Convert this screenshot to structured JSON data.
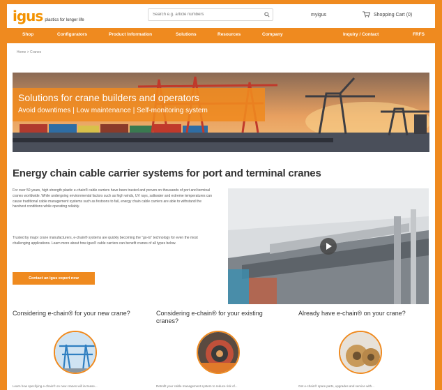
{
  "header": {
    "logo_text": "igus",
    "tagline": "plastics for longer life",
    "search_placeholder": "Search e.g. article numbers",
    "account_label": "myigus",
    "cart_label": "Shopping Cart (0)"
  },
  "nav": {
    "items": [
      "Shop",
      "Configurators",
      "Product Information",
      "Solutions",
      "Resources",
      "Company"
    ],
    "right_items": [
      "Inquiry / Contact",
      "FRFS"
    ]
  },
  "breadcrumb": [
    "Home",
    "Cranes"
  ],
  "hero": {
    "title": "Solutions for crane builders and operators",
    "subtitle": "Avoid downtimes | Low maintenance | Self-monitoring system"
  },
  "main": {
    "heading": "Energy chain cable carrier systems for port and terminal cranes",
    "paragraph1": "For over 50 years, high strength plastic e-chain® cable carriers have been trusted and proven on thousands of port and terminal cranes worldwide. While undergoing environmental factors such as high winds, UV rays, saltwater and extreme temperatures can cause traditional cable management systems such as festoons to fail, energy chain cable carriers are able to withstand the harshest conditions while operating reliably.",
    "paragraph2": "Trusted by major crane manufacturers, e-chain® systems are quickly becoming the \"go-to\" technology for even the most challenging applications. Learn more about how igus® cable carriers can benefit cranes of all types below.",
    "cta_label": "Contact an igus expert now"
  },
  "cards": [
    {
      "title": "Considering e-chain® for your new crane?",
      "text": "Learn how specifying e-chain® on new cranes will increase..."
    },
    {
      "title": "Considering e-chain® for your existing cranes?",
      "text": "Retrofit your cable management system to reduce risk of..."
    },
    {
      "title": "Already have e-chain® on your crane?",
      "text": "Get e-chain® spare parts, upgrades and service with..."
    }
  ],
  "colors": {
    "brand_orange": "#ef8a1f",
    "text_dark": "#333333"
  }
}
